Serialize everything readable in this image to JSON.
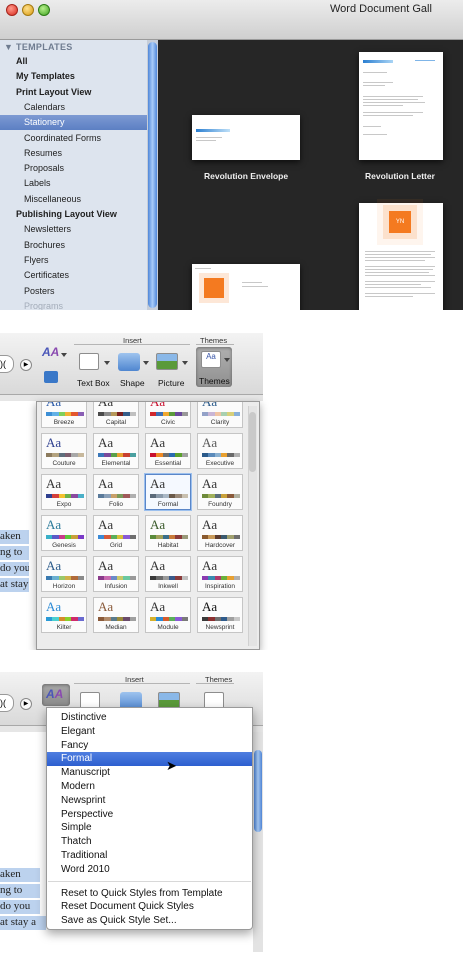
{
  "window": {
    "title": "Word Document Gall"
  },
  "sidebar": {
    "heading": "TEMPLATES",
    "items": [
      {
        "label": "All",
        "level": 0
      },
      {
        "label": "My Templates",
        "level": 0
      },
      {
        "label": "Print Layout View",
        "level": 0
      },
      {
        "label": "Calendars",
        "level": 1
      },
      {
        "label": "Stationery",
        "level": 1,
        "selected": true
      },
      {
        "label": "Coordinated Forms",
        "level": 1
      },
      {
        "label": "Resumes",
        "level": 1
      },
      {
        "label": "Proposals",
        "level": 1
      },
      {
        "label": "Labels",
        "level": 1
      },
      {
        "label": "Miscellaneous",
        "level": 1
      },
      {
        "label": "Publishing Layout View",
        "level": 0
      },
      {
        "label": "Newsletters",
        "level": 1
      },
      {
        "label": "Brochures",
        "level": 1
      },
      {
        "label": "Flyers",
        "level": 1
      },
      {
        "label": "Certificates",
        "level": 1
      },
      {
        "label": "Posters",
        "level": 1
      },
      {
        "label": "Programs",
        "level": 1
      }
    ]
  },
  "gallery": {
    "items": [
      {
        "caption": "Revolution Envelope"
      },
      {
        "caption": "Revolution Letter"
      }
    ],
    "badge_text": "YN"
  },
  "ribbon": {
    "insert_group": "Insert",
    "themes_group": "Themes",
    "text_box": "Text Box",
    "shape": "Shape",
    "picture": "Picture",
    "themes": "Themes"
  },
  "doc_fragments_top": [
    "aken",
    "ng to",
    "do you",
    "at stay"
  ],
  "doc_fragments_bottom": [
    "aken",
    "ng to",
    "do you",
    "at stay a"
  ],
  "themes_gallery": {
    "sample_text": "Aa",
    "tiles": [
      {
        "name": "Breeze",
        "colors": [
          "#3d8fd6",
          "#62b1e6",
          "#7fcf5a",
          "#f2b134",
          "#e4572e",
          "#8a5fb5"
        ]
      },
      {
        "name": "Capital",
        "colors": [
          "#4a4a4a",
          "#8a8a8a",
          "#b5985a",
          "#7a1f1f",
          "#355e8a",
          "#c0c0c0"
        ]
      },
      {
        "name": "Civic",
        "colors": [
          "#d1282e",
          "#3d6fb5",
          "#f0a830",
          "#5b9b3c",
          "#6b4a9c",
          "#999999"
        ]
      },
      {
        "name": "Clarity",
        "colors": [
          "#93a2c8",
          "#c9b6d6",
          "#f0c4a4",
          "#a8d0b0",
          "#d8d07a",
          "#8ab0d8"
        ]
      },
      {
        "name": "Couture",
        "colors": [
          "#8c7b5e",
          "#b3a27e",
          "#5e6e7c",
          "#7c5e6e",
          "#a8a8a8",
          "#c7b89c"
        ]
      },
      {
        "name": "Elemental",
        "colors": [
          "#3a77b9",
          "#7a4a9c",
          "#5aa04a",
          "#e8a030",
          "#c84030",
          "#4aa0a0"
        ]
      },
      {
        "name": "Essential",
        "colors": [
          "#c8102e",
          "#f08a24",
          "#6e6e6e",
          "#2a6ab0",
          "#5aa02c",
          "#a0a0a0"
        ]
      },
      {
        "name": "Executive",
        "colors": [
          "#2a5a8a",
          "#5a8aba",
          "#8ab0d0",
          "#e8a030",
          "#6a6a6a",
          "#b0b0b0"
        ]
      },
      {
        "name": "Expo",
        "colors": [
          "#2e3f8f",
          "#d43f3a",
          "#f2c12e",
          "#6bb14a",
          "#8a4aa0",
          "#4ab0c8"
        ]
      },
      {
        "name": "Folio",
        "colors": [
          "#5a7a9a",
          "#8aa0b8",
          "#c8a06a",
          "#7a9a5a",
          "#a05a5a",
          "#b0b0b0"
        ]
      },
      {
        "name": "Formal",
        "colors": [
          "#5a6a7a",
          "#8a9aaa",
          "#aab8c6",
          "#6a5a4a",
          "#9a8a7a",
          "#c8c0b0"
        ],
        "selected": true
      },
      {
        "name": "Foundry",
        "colors": [
          "#6e8a3a",
          "#a0b05a",
          "#5a6e7a",
          "#c8a03a",
          "#8a5a3a",
          "#b0b0a0"
        ]
      },
      {
        "name": "Genesis",
        "colors": [
          "#3ab0c8",
          "#5a5ac8",
          "#c83a8a",
          "#5ac83a",
          "#c8a03a",
          "#7a3ac8"
        ]
      },
      {
        "name": "Grid",
        "colors": [
          "#3a8ad6",
          "#d65a3a",
          "#5aae5a",
          "#d6c03a",
          "#8a5ad6",
          "#6e6e6e"
        ]
      },
      {
        "name": "Habitat",
        "colors": [
          "#5a8a3a",
          "#a0a05a",
          "#3a6e8a",
          "#c87a3a",
          "#8a3a3a",
          "#9a9a7a"
        ]
      },
      {
        "name": "Hardcover",
        "colors": [
          "#8a5a2e",
          "#c89a5a",
          "#5a3a2e",
          "#3a5a6e",
          "#a0a06e",
          "#6e6e6e"
        ]
      },
      {
        "name": "Horizon",
        "colors": [
          "#3a7ab0",
          "#6ab0d0",
          "#9ac86a",
          "#d0b04a",
          "#b06a3a",
          "#8a8a8a"
        ]
      },
      {
        "name": "Infusion",
        "colors": [
          "#8a3a8a",
          "#c86ab0",
          "#6a8ac8",
          "#c8c86a",
          "#6ac8a0",
          "#9a9a9a"
        ]
      },
      {
        "name": "Inkwell",
        "colors": [
          "#3a3a3a",
          "#6a6a6a",
          "#9a9a9a",
          "#3a5a8a",
          "#8a3a3a",
          "#c0c0c0"
        ]
      },
      {
        "name": "Inspiration",
        "colors": [
          "#8a3ab0",
          "#3a8ab0",
          "#b03a6a",
          "#6ab03a",
          "#e8a030",
          "#b0b0b0"
        ]
      },
      {
        "name": "Kilter",
        "colors": [
          "#2a9ad6",
          "#4ad0d0",
          "#d68a2a",
          "#8ad02a",
          "#d02a6a",
          "#6a6ad0"
        ]
      },
      {
        "name": "Median",
        "colors": [
          "#8a5a3a",
          "#b08a6a",
          "#5a7a8a",
          "#9a8a3a",
          "#6a4a6a",
          "#a0a0a0"
        ]
      },
      {
        "name": "Module",
        "colors": [
          "#d6b02a",
          "#2a8ad6",
          "#d65a2a",
          "#5ab05a",
          "#8a5ad6",
          "#7a7a7a"
        ]
      },
      {
        "name": "Newsprint",
        "colors": [
          "#3a3a3a",
          "#8a2e2e",
          "#6e6e6e",
          "#2e5a8a",
          "#a0a0a0",
          "#c8c8c8"
        ]
      }
    ]
  },
  "quick_styles_menu": {
    "items": [
      "Distinctive",
      "Elegant",
      "Fancy",
      "Formal",
      "Manuscript",
      "Modern",
      "Newsprint",
      "Perspective",
      "Simple",
      "Thatch",
      "Traditional",
      "Word 2010"
    ],
    "selected": "Formal",
    "actions": [
      "Reset to Quick Styles from Template",
      "Reset Document Quick Styles",
      "Save as Quick Style Set..."
    ]
  },
  "colors": {
    "selection_blue": "#2d5fcf",
    "sidebar_bg": "#dde4ee",
    "gallery_bg": "#262626",
    "highlight": "#bcd2ee"
  }
}
